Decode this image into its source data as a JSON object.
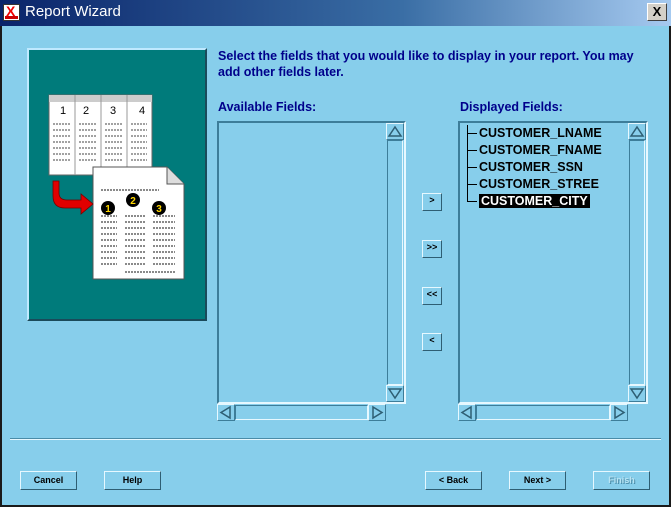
{
  "window": {
    "title": "Report Wizard",
    "close_label": "X"
  },
  "illustration": {
    "column_numbers": [
      "1",
      "2",
      "3",
      "4"
    ],
    "step_numbers": [
      "1",
      "2",
      "3"
    ]
  },
  "instructions": "Select the fields that you would like to display in your report. You may add other fields later.",
  "available": {
    "label": "Available Fields:",
    "items": []
  },
  "displayed": {
    "label": "Displayed Fields:",
    "items": [
      "CUSTOMER_LNAME",
      "CUSTOMER_FNAME",
      "CUSTOMER_SSN",
      "CUSTOMER_STREE",
      "CUSTOMER_CITY"
    ],
    "selected": "CUSTOMER_CITY"
  },
  "move_buttons": {
    "add_one": ">",
    "add_all": ">>",
    "remove_all": "<<",
    "remove_one": "<"
  },
  "buttons": {
    "cancel": "Cancel",
    "help": "Help",
    "back": "< Back",
    "next": "Next >",
    "finish": "Finish"
  },
  "colors": {
    "background": "#87ceeb",
    "illustration_bg": "#007b7b",
    "text": "#00008b",
    "titlebar": "#0a246a"
  }
}
